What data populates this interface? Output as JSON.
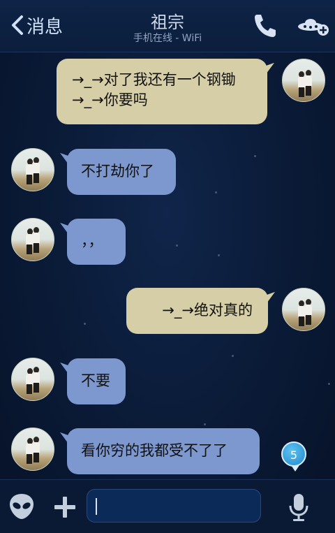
{
  "header": {
    "back_label": "消息",
    "title": "祖宗",
    "subtitle": "手机在线 - WiFi",
    "icons": [
      "chevron-left-icon",
      "phone-icon",
      "ufo-add-icon"
    ]
  },
  "messages": [
    {
      "direction": "outgoing",
      "text": "→_→对了我还有一个钢锄→_→你要吗"
    },
    {
      "direction": "incoming",
      "text": "不打劫你了"
    },
    {
      "direction": "incoming",
      "text": "，，"
    },
    {
      "direction": "outgoing",
      "text": "→_→绝对真的"
    },
    {
      "direction": "incoming",
      "text": "不要"
    },
    {
      "direction": "incoming",
      "text": "看你穷的我都受不了了"
    }
  ],
  "unread_badge": "5",
  "input_bar": {
    "placeholder": "",
    "icons": [
      "alien-icon",
      "plus-icon",
      "microphone-icon"
    ]
  },
  "colors": {
    "background": "#0a1a36",
    "incoming_bubble": "#7c98cf",
    "outgoing_bubble": "#d6cea6",
    "badge": "#2389cf"
  }
}
